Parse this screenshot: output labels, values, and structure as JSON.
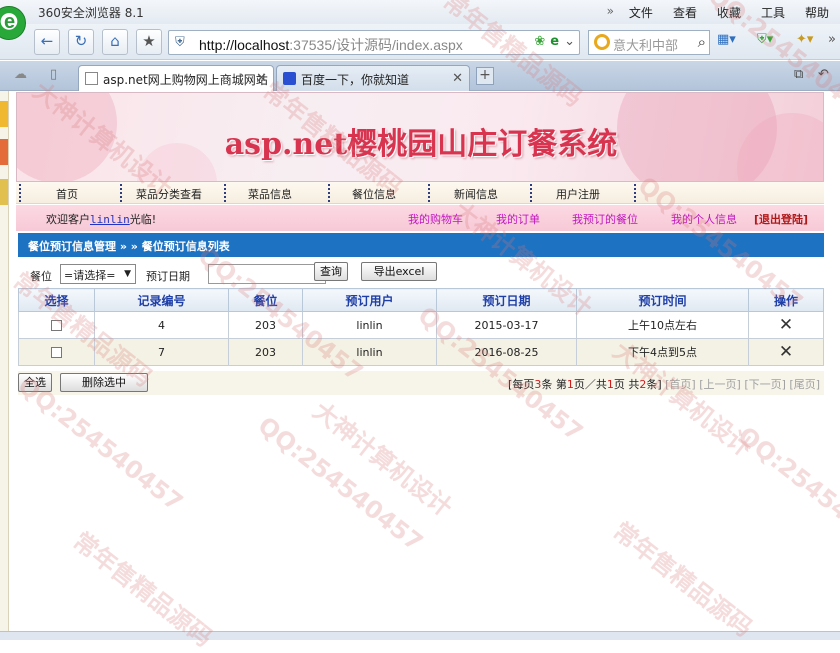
{
  "browser": {
    "app_title": "360安全浏览器 8.1",
    "menu": [
      "文件",
      "查看",
      "收藏",
      "工具",
      "帮助"
    ],
    "menu_arrow": "»",
    "address_host": "http://localhost",
    "address_rest": ":37535/设计源码/index.aspx",
    "search_placeholder": "意大利中部",
    "tabs": [
      {
        "label": "asp.net网上购物网上商城网站",
        "icon": "page-icon"
      },
      {
        "label": "百度一下，你就知道",
        "icon": "baidu-paw-icon"
      }
    ]
  },
  "site": {
    "banner_title": "asp.net樱桃园山庄订餐系统",
    "nav": [
      "首页",
      "菜品分类查看",
      "菜品信息",
      "餐位信息",
      "新闻信息",
      "用户注册"
    ],
    "welcome_prefix": "欢迎客户",
    "welcome_user": "linlin",
    "welcome_suffix": "光临!",
    "user_links": [
      "我的购物车",
      "我的订单",
      "我预订的餐位",
      "我的个人信息"
    ],
    "logout": "[退出登陆]"
  },
  "panel": {
    "breadcrumb": "餐位预订信息管理 » » 餐位预订信息列表",
    "filter": {
      "seat_label": "餐位",
      "seat_selected": "=请选择=",
      "date_label": "预订日期",
      "date_value": "",
      "query_button": "查询",
      "export_button": "导出excel"
    },
    "columns": [
      "选择",
      "记录编号",
      "餐位",
      "预订用户",
      "预订日期",
      "预订时间",
      "操作"
    ],
    "rows": [
      {
        "id": "4",
        "seat": "203",
        "user": "linlin",
        "date": "2015-03-17",
        "time": "上午10点左右",
        "action": "✕"
      },
      {
        "id": "7",
        "seat": "203",
        "user": "linlin",
        "date": "2016-08-25",
        "time": "下午4点到5点",
        "action": "✕"
      }
    ],
    "select_all": "全选",
    "delete_selected": "删除选中",
    "pager": {
      "per_page_prefix": "[每页",
      "per_page": "3",
      "per_page_suffix": "条",
      "page_prefix": "第",
      "page": "1",
      "page_mid": "页／共",
      "pages": "1",
      "page_suffix": "页",
      "total_prefix": "共",
      "total": "2",
      "total_suffix": "条]",
      "first": "[首页]",
      "prev": "[上一页]",
      "next": "[下一页]",
      "last": "[尾页]"
    }
  },
  "watermarks": [
    "常年售精品源码",
    "QQ:254540457",
    "大神计算机设计"
  ]
}
